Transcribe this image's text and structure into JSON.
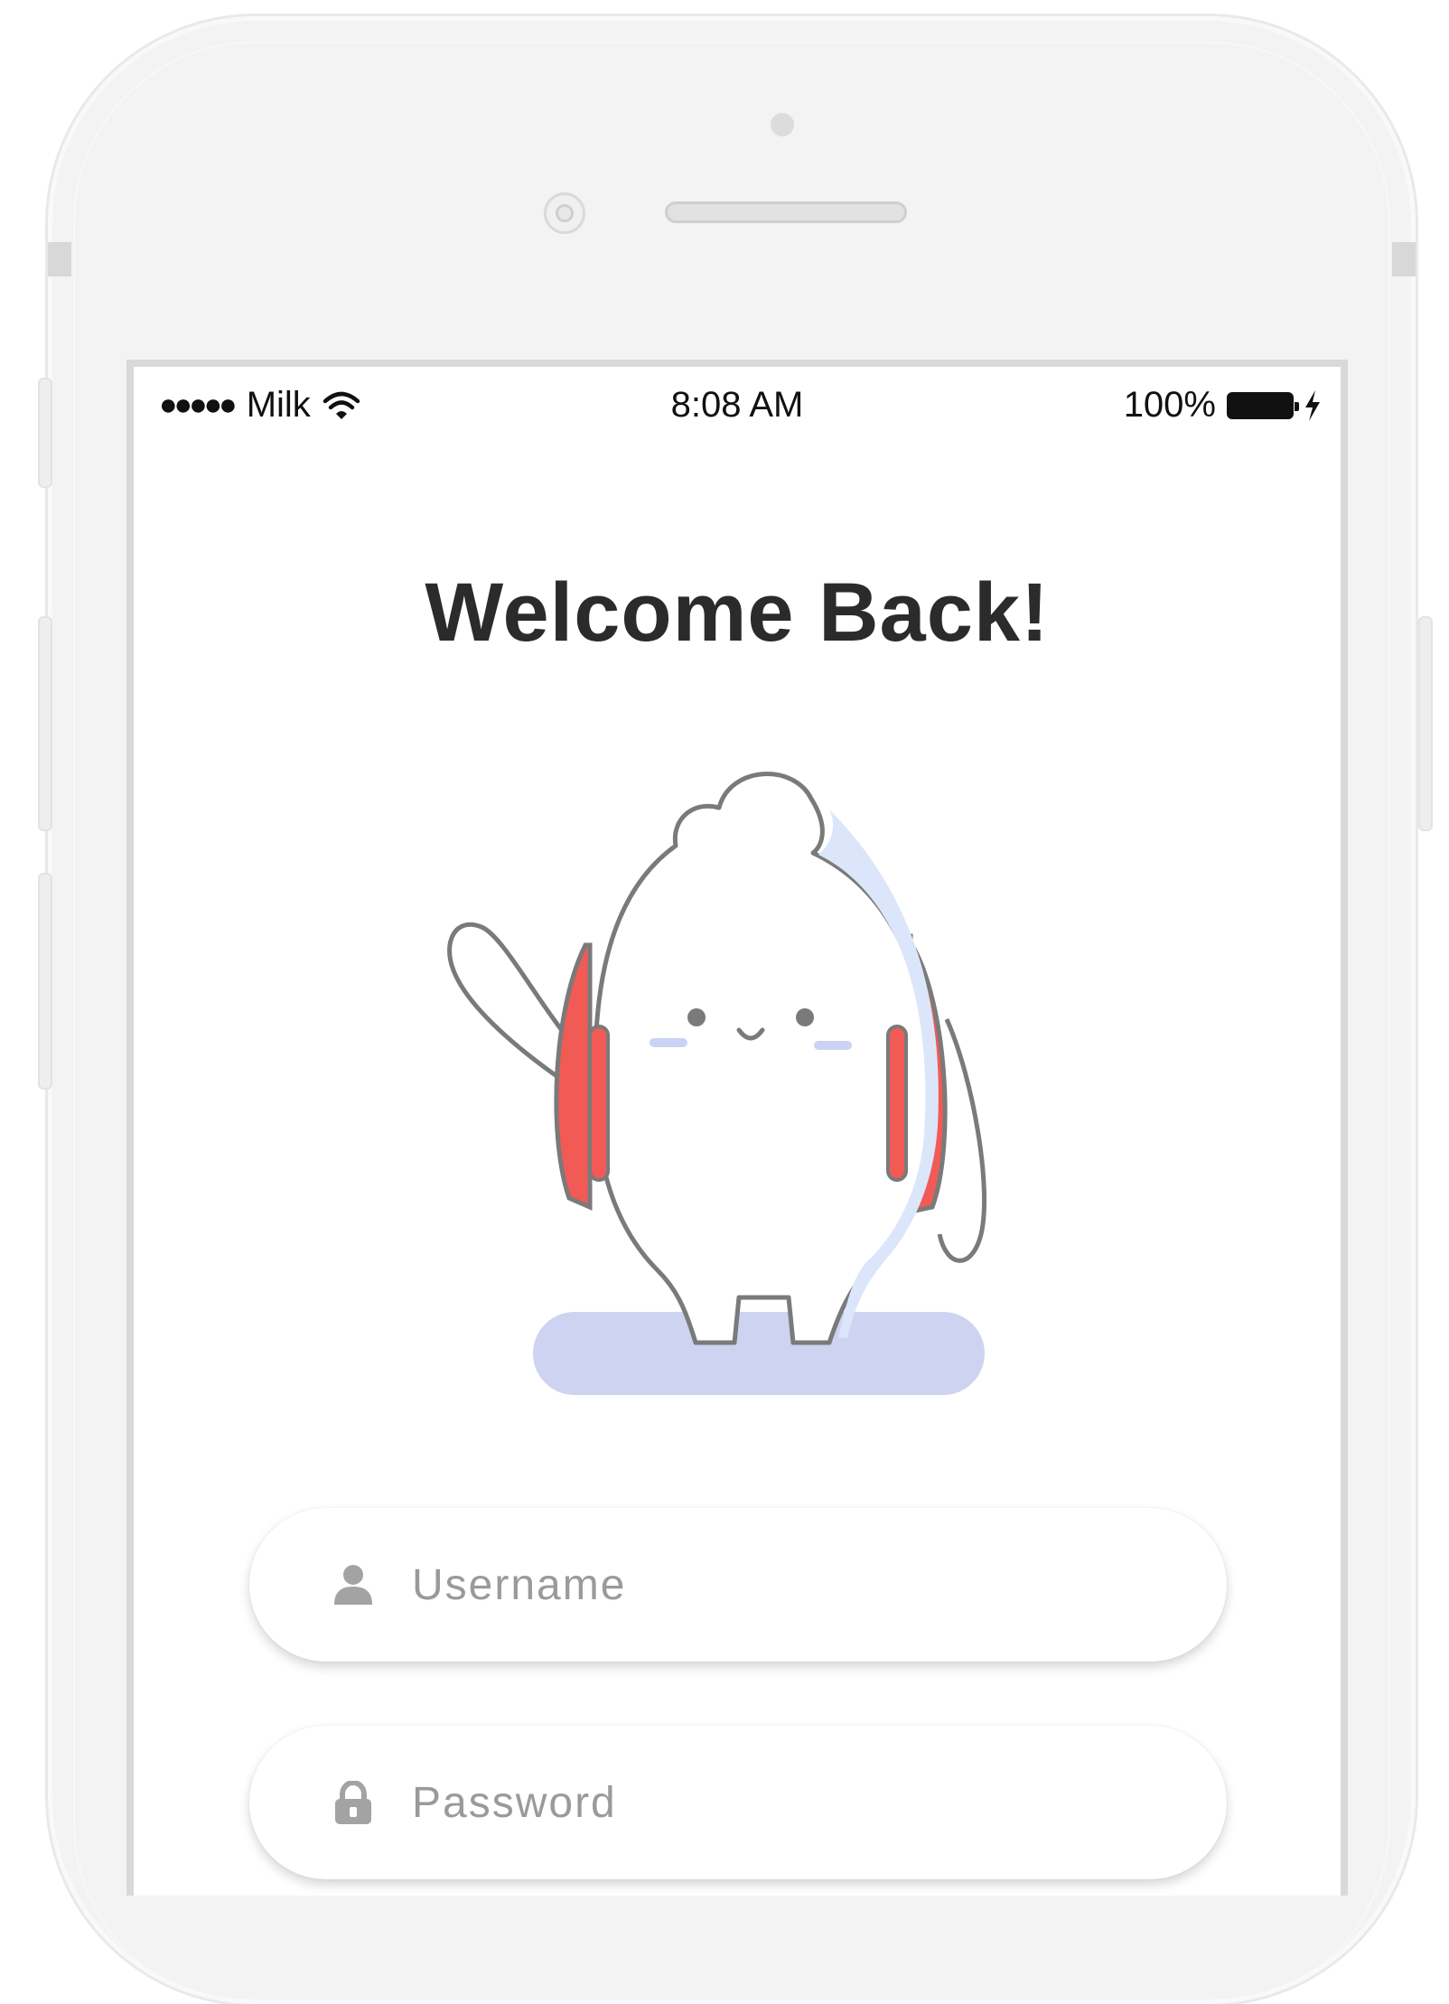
{
  "status_bar": {
    "signal": "●●●●●",
    "carrier": "Milk",
    "wifi_icon": "wifi-icon",
    "time": "8:08 AM",
    "battery_percent": "100%",
    "battery_icon": "battery-full-icon",
    "charging_icon": "lightning-bolt-icon"
  },
  "login": {
    "title": "Welcome Back!",
    "username_placeholder": "Username",
    "password_placeholder": "Password",
    "username_icon": "user-icon",
    "password_icon": "lock-icon"
  },
  "colors": {
    "backpack_strap": "#f25a55",
    "shadow": "#cdd3f1",
    "blush": "#cad3f4",
    "outline": "#7a7a7a",
    "title": "#2b2b2b",
    "placeholder": "#9a9a9a"
  }
}
